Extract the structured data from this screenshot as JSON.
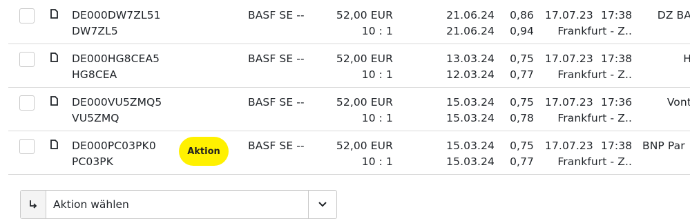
{
  "rows": [
    {
      "isin": "DE000DW7ZL51",
      "wkn": "DW7ZL5",
      "badge": "",
      "underlying": "BASF SE --",
      "strike": "52,00 EUR",
      "ratio": "10 : 1",
      "date1": "21.06.24",
      "date2": "21.06.24",
      "bid": "0,86",
      "ask": "0,94",
      "date": "17.07.23",
      "time": "17:38",
      "exchange": "Frankfurt - Z..",
      "issuer": "DZ BA"
    },
    {
      "isin": "DE000HG8CEA5",
      "wkn": "HG8CEA",
      "badge": "",
      "underlying": "BASF SE --",
      "strike": "52,00 EUR",
      "ratio": "10 : 1",
      "date1": "13.03.24",
      "date2": "12.03.24",
      "bid": "0,75",
      "ask": "0,77",
      "date": "17.07.23",
      "time": "17:38",
      "exchange": "Frankfurt - Z..",
      "issuer": "H"
    },
    {
      "isin": "DE000VU5ZMQ5",
      "wkn": "VU5ZMQ",
      "badge": "",
      "underlying": "BASF SE --",
      "strike": "52,00 EUR",
      "ratio": "10 : 1",
      "date1": "15.03.24",
      "date2": "15.03.24",
      "bid": "0,75",
      "ask": "0,78",
      "date": "17.07.23",
      "time": "17:36",
      "exchange": "Frankfurt - Z..",
      "issuer": "Vont"
    },
    {
      "isin": "DE000PC03PK0",
      "wkn": "PC03PK",
      "badge": "Aktion",
      "underlying": "BASF SE --",
      "strike": "52,00 EUR",
      "ratio": "10 : 1",
      "date1": "15.03.24",
      "date2": "15.03.24",
      "bid": "0,75",
      "ask": "0,77",
      "date": "17.07.23",
      "time": "17:38",
      "exchange": "Frankfurt - Z..",
      "issuer": "BNP Par"
    }
  ],
  "action_select": {
    "label": "Aktion wählen"
  },
  "colors": {
    "badge": "#fff100",
    "border": "#d9d9d9"
  },
  "icons": {
    "row_doc": "document-icon",
    "action_arrow": "arrow-turn-icon",
    "caret": "chevron-down-icon"
  }
}
